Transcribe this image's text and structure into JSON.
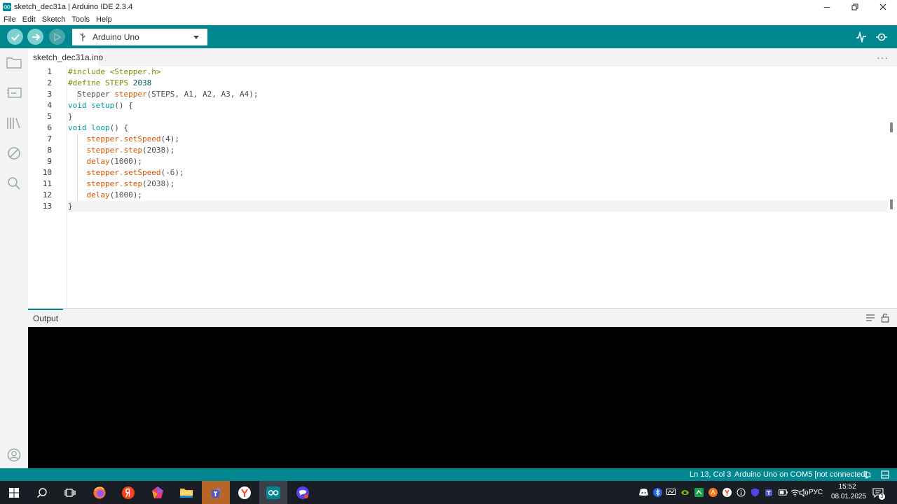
{
  "window": {
    "title": "sketch_dec31a | Arduino IDE 2.3.4"
  },
  "menu": [
    "File",
    "Edit",
    "Sketch",
    "Tools",
    "Help"
  ],
  "toolbar": {
    "board": "Arduino Uno"
  },
  "editor": {
    "tab": "sketch_dec31a.ino",
    "line_numbers": [
      "1",
      "2",
      "3",
      "4",
      "5",
      "6",
      "7",
      "8",
      "9",
      "10",
      "11",
      "12",
      "13"
    ],
    "lines": [
      [
        {
          "t": "#include <Stepper.h>",
          "c": "pre"
        }
      ],
      [
        {
          "t": "#define STEPS ",
          "c": "pre"
        },
        {
          "t": "2038",
          "c": "num"
        }
      ],
      [
        {
          "t": "  Stepper ",
          "c": ""
        },
        {
          "t": "stepper",
          "c": "fn"
        },
        {
          "t": "(STEPS, A1, A2, A3, A4);",
          "c": ""
        }
      ],
      [
        {
          "t": "void",
          "c": "type"
        },
        {
          "t": " ",
          "c": ""
        },
        {
          "t": "setup",
          "c": "type"
        },
        {
          "t": "() {",
          "c": ""
        }
      ],
      [
        {
          "t": "}",
          "c": ""
        }
      ],
      [
        {
          "t": "void",
          "c": "type"
        },
        {
          "t": " ",
          "c": ""
        },
        {
          "t": "loop",
          "c": "type"
        },
        {
          "t": "() {",
          "c": ""
        }
      ],
      [
        {
          "t": "    ",
          "c": ""
        },
        {
          "t": "stepper.setSpeed",
          "c": "fn"
        },
        {
          "t": "(4);",
          "c": ""
        }
      ],
      [
        {
          "t": "    ",
          "c": ""
        },
        {
          "t": "stepper.step",
          "c": "fn"
        },
        {
          "t": "(2038);",
          "c": ""
        }
      ],
      [
        {
          "t": "    ",
          "c": ""
        },
        {
          "t": "delay",
          "c": "fn"
        },
        {
          "t": "(1000);",
          "c": ""
        }
      ],
      [
        {
          "t": "    ",
          "c": ""
        },
        {
          "t": "stepper.setSpeed",
          "c": "fn"
        },
        {
          "t": "(-6);",
          "c": ""
        }
      ],
      [
        {
          "t": "    ",
          "c": ""
        },
        {
          "t": "stepper.step",
          "c": "fn"
        },
        {
          "t": "(2038);",
          "c": ""
        }
      ],
      [
        {
          "t": "    ",
          "c": ""
        },
        {
          "t": "delay",
          "c": "fn"
        },
        {
          "t": "(1000);",
          "c": ""
        }
      ],
      [
        {
          "t": "}",
          "c": ""
        }
      ]
    ]
  },
  "output": {
    "title": "Output"
  },
  "status": {
    "position": "Ln 13, Col 3",
    "board": "Arduino Uno on COM5 [not connected]"
  },
  "taskbar": {
    "lang": "РУС",
    "time": "15:52",
    "date": "08.01.2025",
    "notifications": "3"
  },
  "colors": {
    "accent": "#00878f",
    "keyword": "#00979d",
    "function": "#d35400",
    "preprocessor": "#728e00"
  }
}
